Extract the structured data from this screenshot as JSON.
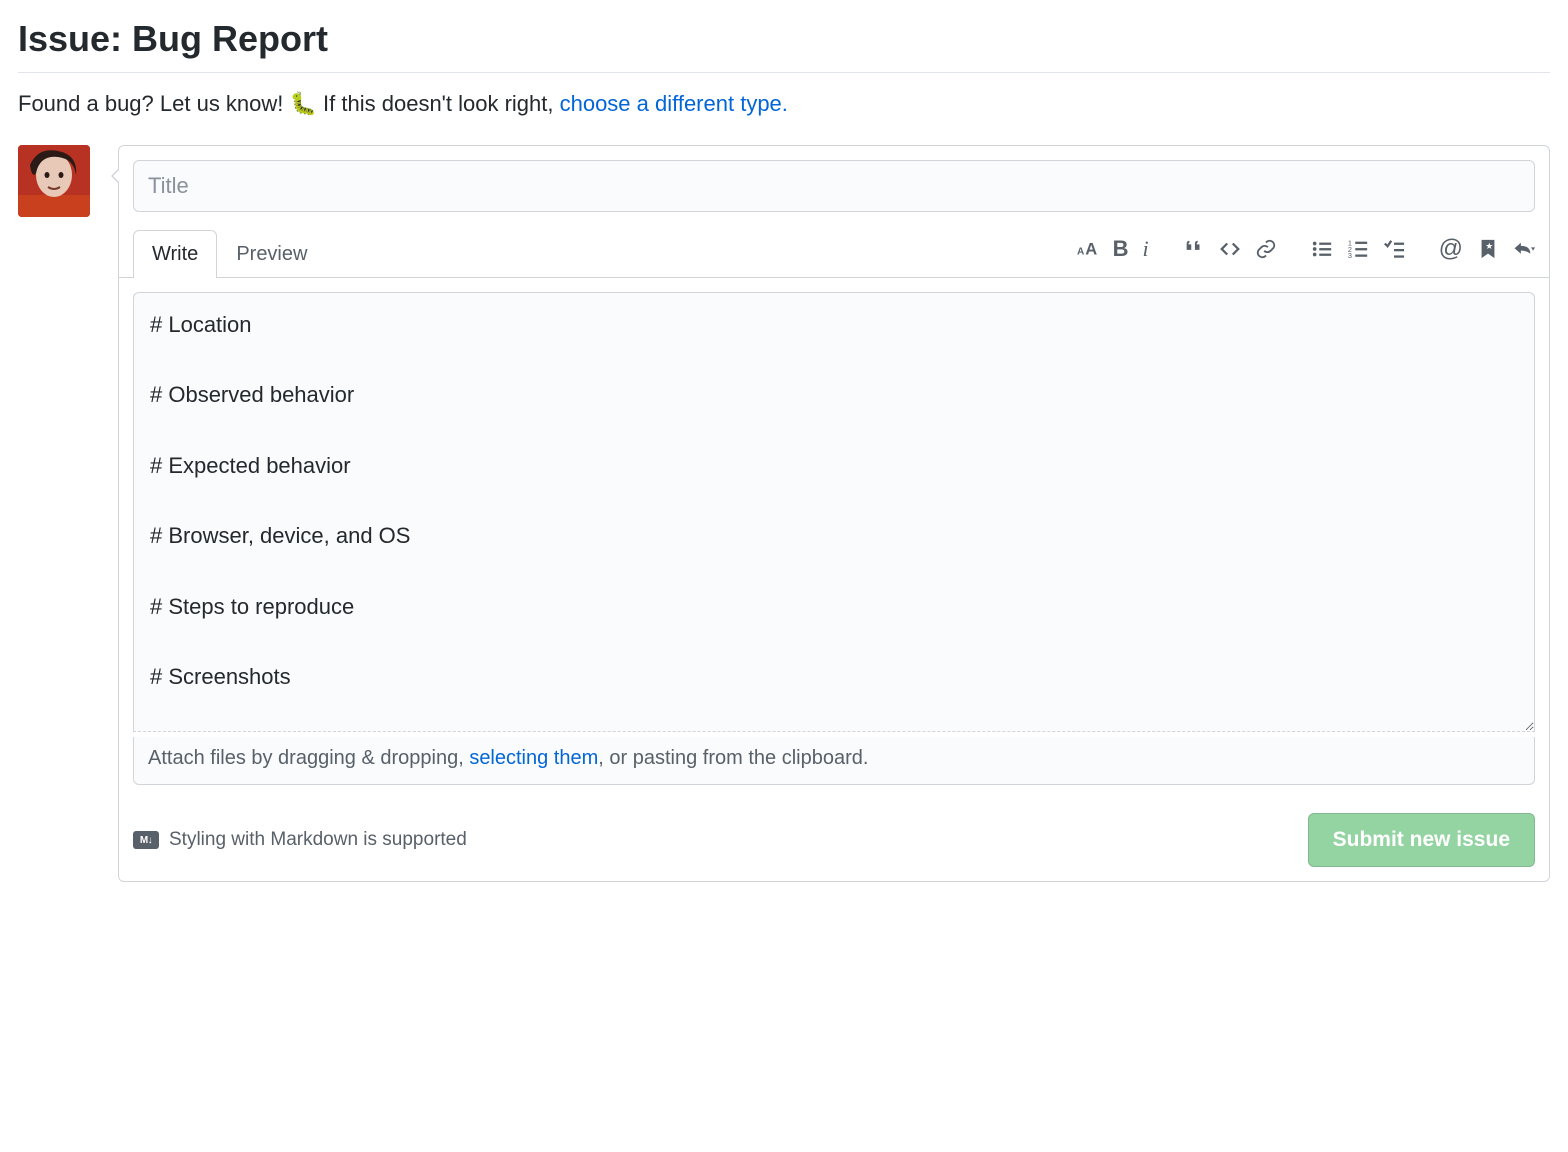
{
  "header": {
    "title": "Issue: Bug Report",
    "intro_prefix": "Found a bug? Let us know! ",
    "intro_emoji": "🐛",
    "intro_middle": "   If this doesn't look right, ",
    "intro_link": "choose a different type."
  },
  "form": {
    "title_placeholder": "Title",
    "tabs": {
      "write": "Write",
      "preview": "Preview",
      "active": "write"
    },
    "body_value": "# Location\n\n# Observed behavior\n\n# Expected behavior\n\n# Browser, device, and OS\n\n# Steps to reproduce\n\n# Screenshots",
    "attach": {
      "before": "Attach files by dragging & dropping, ",
      "link": "selecting them",
      "after": ", or pasting from the clipboard."
    },
    "markdown_hint": "Styling with Markdown is supported",
    "submit_label": "Submit new issue"
  },
  "toolbar": {
    "groups": [
      [
        "text-size",
        "bold",
        "italic"
      ],
      [
        "quote",
        "code",
        "link"
      ],
      [
        "bulleted-list",
        "numbered-list",
        "task-list"
      ],
      [
        "mention",
        "reference",
        "reply"
      ]
    ]
  }
}
